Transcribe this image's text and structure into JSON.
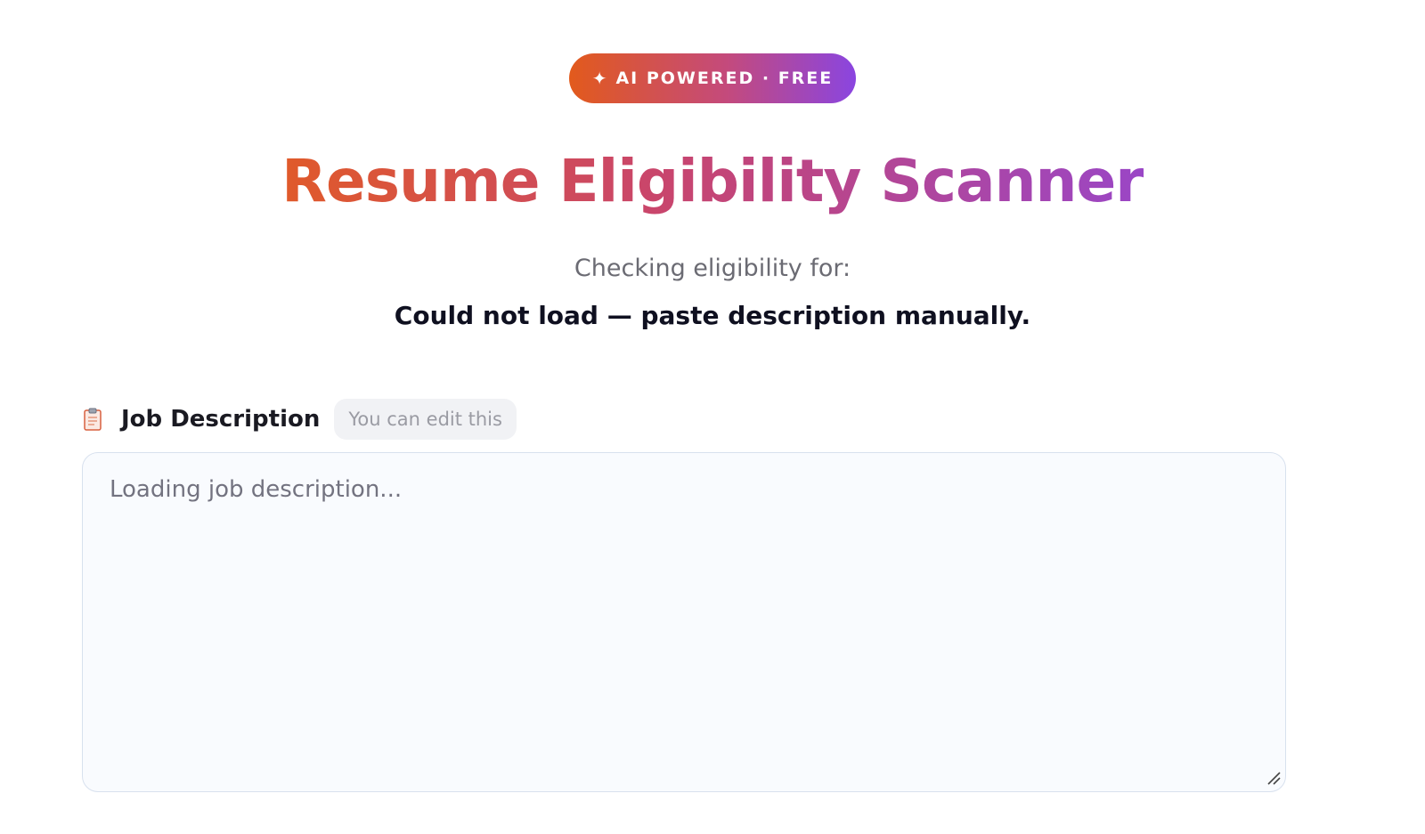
{
  "badge": {
    "icon": "sparkle-icon",
    "icon_glyph": "✦",
    "label": "AI POWERED · FREE"
  },
  "header": {
    "title": "Resume Eligibility Scanner",
    "subtitle": "Checking eligibility for:",
    "target": "Could not load — paste description manually."
  },
  "job_description": {
    "icon": "clipboard-icon",
    "label": "Job Description",
    "edit_hint": "You can edit this",
    "value": "",
    "placeholder": "Loading job description..."
  },
  "colors": {
    "gradient_start": "#e25a1c",
    "gradient_end": "#8a45e0",
    "text_dark": "#0f1020",
    "text_muted": "#6b6b73",
    "field_background": "#f9fbfe",
    "field_border": "#d8e1ee"
  }
}
